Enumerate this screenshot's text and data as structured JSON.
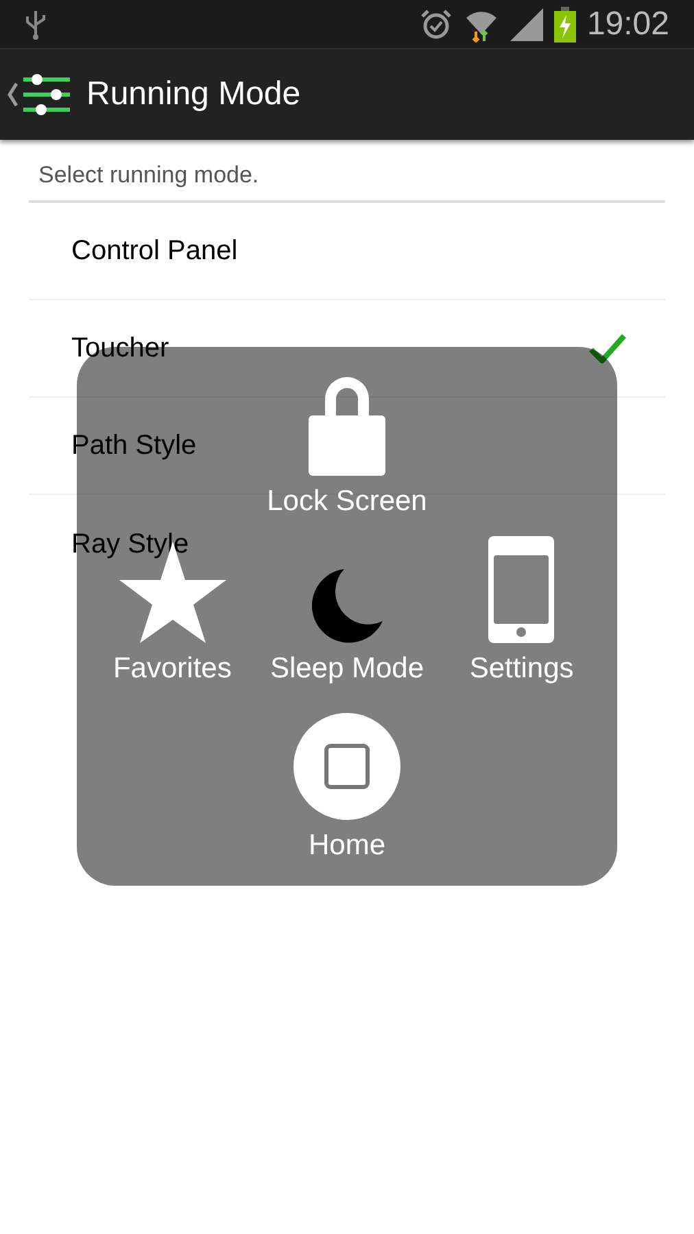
{
  "status_bar": {
    "time": "19:02"
  },
  "header": {
    "title": "Running Mode"
  },
  "subtitle": "Select running mode.",
  "modes": [
    {
      "label": "Control Panel",
      "selected": false
    },
    {
      "label": "Toucher",
      "selected": true
    },
    {
      "label": "Path Style",
      "selected": false
    },
    {
      "label": "Ray Style",
      "selected": false
    }
  ],
  "menu": {
    "rows": [
      [
        {
          "kind": "lock",
          "label": "Lock Screen"
        }
      ],
      [
        {
          "kind": "star",
          "label": "Favorites"
        },
        {
          "kind": "moon",
          "label": "Sleep Mode"
        },
        {
          "kind": "phone",
          "label": "Settings"
        }
      ],
      [
        {
          "kind": "home",
          "label": "Home"
        }
      ]
    ]
  }
}
